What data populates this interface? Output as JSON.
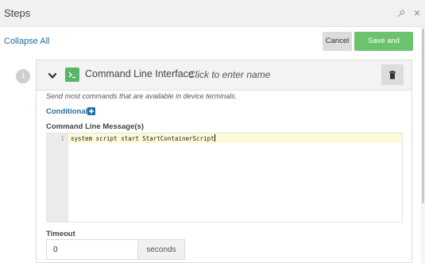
{
  "window": {
    "title": "Steps",
    "pin_icon": "pin-icon",
    "close_symbol": "×"
  },
  "toolbar": {
    "collapse_all": "Collapse All",
    "cancel_label": "Cancel",
    "save_label": "Save and continue"
  },
  "step": {
    "number": "1",
    "type": "Command Line Interface",
    "name_placeholder": "Click to enter name",
    "description": "Send most commands that are available in device terminals.",
    "conditional_label": "Conditional",
    "message_label": "Command Line Message(s)",
    "editor": {
      "line_numbers": [
        "1"
      ],
      "lines": [
        "system script start StartContainerScript"
      ]
    },
    "timeout_label": "Timeout",
    "timeout_value": "0",
    "timeout_unit": "seconds"
  },
  "colors": {
    "accent_green": "#6bc36e",
    "link_blue": "#1f6fa3",
    "cli_icon_green": "#5ab565"
  }
}
